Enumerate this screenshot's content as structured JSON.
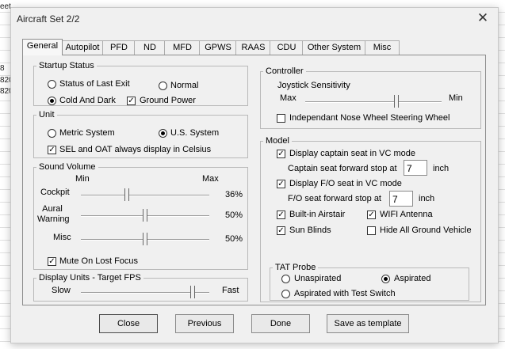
{
  "background": {
    "cells": [
      "eet",
      "8",
      "820",
      "820"
    ]
  },
  "dialog": {
    "title": "Aircraft Set 2/2",
    "close_glyph": "✕"
  },
  "tabs": [
    {
      "label": "General",
      "active": true
    },
    {
      "label": "Autopilot"
    },
    {
      "label": "PFD"
    },
    {
      "label": "ND"
    },
    {
      "label": "MFD"
    },
    {
      "label": "GPWS"
    },
    {
      "label": "RAAS"
    },
    {
      "label": "CDU"
    },
    {
      "label": "Other System"
    },
    {
      "label": "Misc"
    }
  ],
  "startup": {
    "legend": "Startup Status",
    "options": [
      {
        "label": "Status of Last Exit",
        "selected": false
      },
      {
        "label": "Normal",
        "selected": false
      },
      {
        "label": "Cold And Dark",
        "selected": true
      }
    ],
    "ground_power": {
      "label": "Ground Power",
      "checked": true
    }
  },
  "unit": {
    "legend": "Unit",
    "options": [
      {
        "label": "Metric System",
        "selected": false
      },
      {
        "label": "U.S. System",
        "selected": true
      }
    ],
    "celsius": {
      "label": "SEL and OAT always display in Celsius",
      "checked": true
    }
  },
  "sound": {
    "legend": "Sound Volume",
    "min_label": "Min",
    "max_label": "Max",
    "rows": [
      {
        "label": "Cockpit",
        "value": "36%",
        "level": 0.36
      },
      {
        "label": "Aural\nWarning",
        "value": "50%",
        "level": 0.5
      },
      {
        "label": "Misc",
        "value": "50%",
        "level": 0.5
      }
    ],
    "mute": {
      "label": "Mute On Lost Focus",
      "checked": true
    }
  },
  "fps": {
    "legend": "Display Units - Target FPS",
    "slow_label": "Slow",
    "fast_label": "Fast",
    "level": 0.87
  },
  "controller": {
    "legend": "Controller",
    "joystick_label": "Joystick Sensitivity",
    "max_label": "Max",
    "min_label": "Min",
    "level": 0.67,
    "nose_wheel": {
      "label": "Independant Nose Wheel Steering Wheel",
      "checked": false
    }
  },
  "model": {
    "legend": "Model",
    "captain_seat": {
      "label": "Display captain seat in VC mode",
      "checked": true
    },
    "captain_stop": {
      "label": "Captain seat forward stop at",
      "value": "7",
      "unit": "inch"
    },
    "fo_seat": {
      "label": "Display F/O seat in VC mode",
      "checked": true
    },
    "fo_stop": {
      "label": "F/O seat forward stop at",
      "value": "7",
      "unit": "inch"
    },
    "airstair": {
      "label": "Built-in Airstair",
      "checked": true
    },
    "wifi": {
      "label": "WIFI Antenna",
      "checked": true
    },
    "sunblinds": {
      "label": "Sun Blinds",
      "checked": true
    },
    "hide_ground": {
      "label": "Hide All Ground Vehicle",
      "checked": false
    }
  },
  "tat": {
    "legend": "TAT Probe",
    "options": [
      {
        "label": "Unaspirated",
        "selected": false
      },
      {
        "label": "Aspirated",
        "selected": true
      },
      {
        "label": "Aspirated with Test Switch",
        "selected": false
      }
    ]
  },
  "buttons": {
    "close": "Close",
    "previous": "Previous",
    "done": "Done",
    "save_template": "Save as template"
  }
}
